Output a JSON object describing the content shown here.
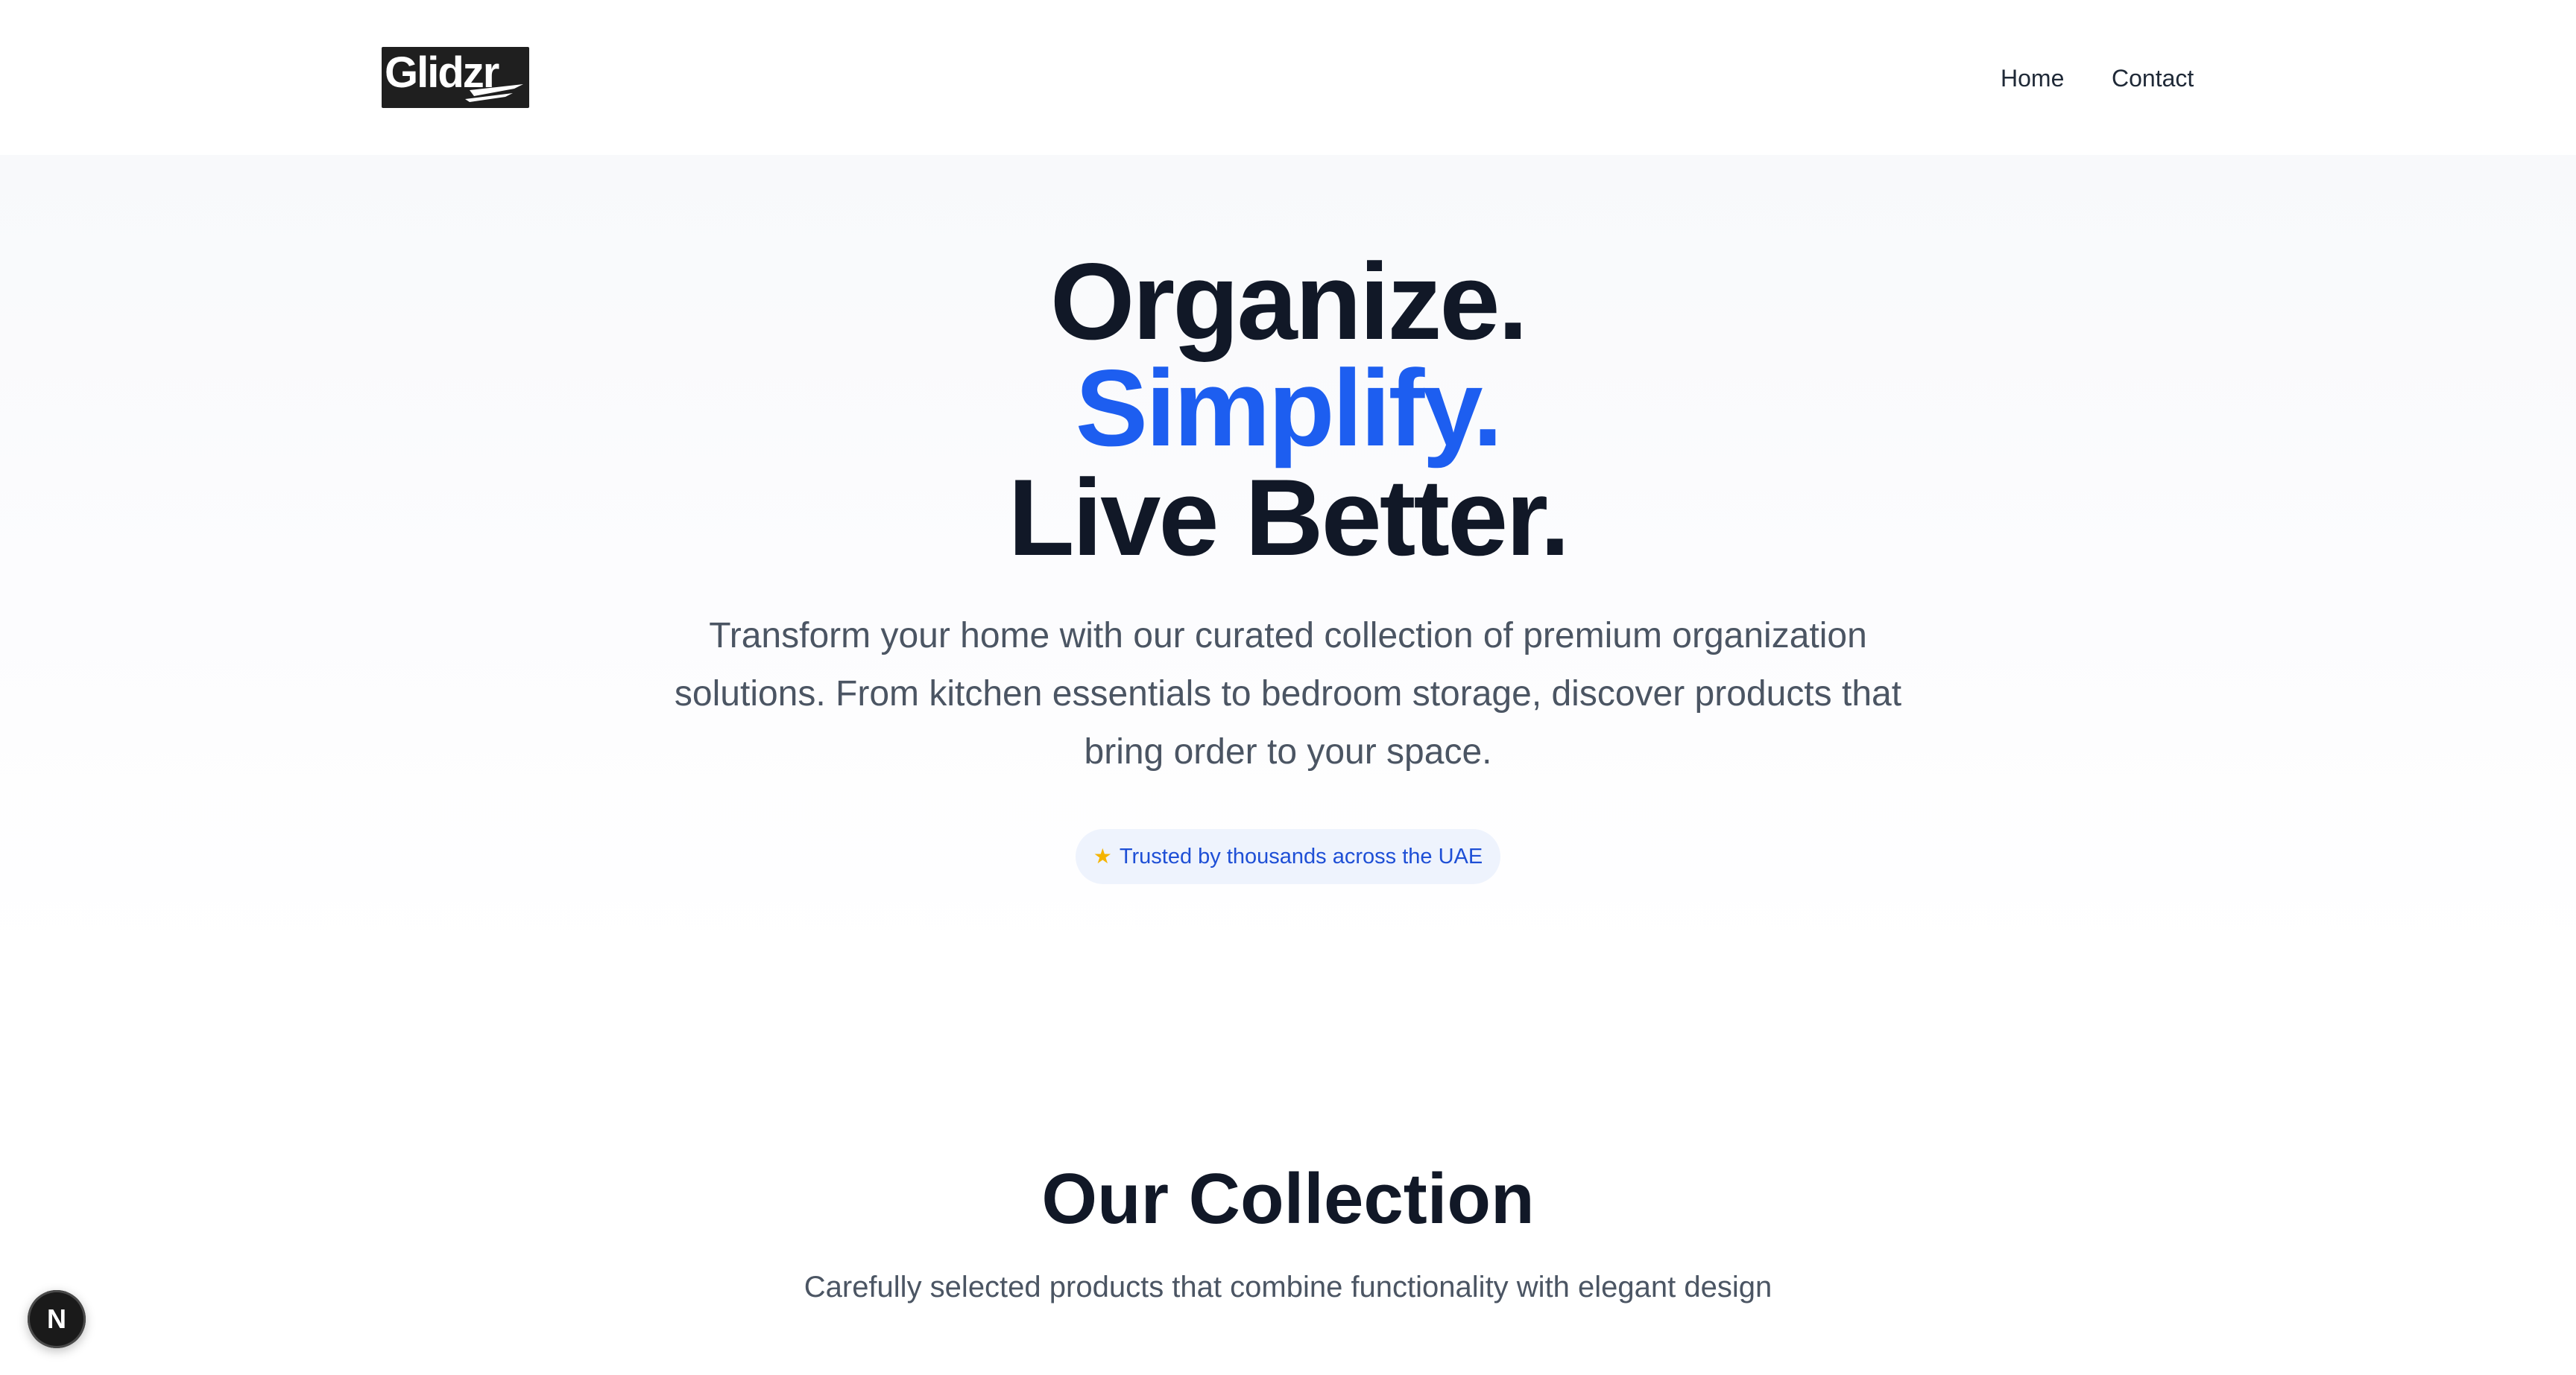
{
  "header": {
    "logo_text": "Glidzr",
    "nav": [
      {
        "label": "Home"
      },
      {
        "label": "Contact"
      }
    ]
  },
  "hero": {
    "line1": "Organize.",
    "line2": "Simplify.",
    "line3": "Live Better.",
    "subtitle": "Transform your home with our curated collection of premium organization solutions. From kitchen essentials to bedroom storage, discover products that bring order to your space.",
    "badge": {
      "icon": "star-icon",
      "text": "Trusted by thousands across the UAE"
    }
  },
  "collection": {
    "title": "Our Collection",
    "subtitle": "Carefully selected products that combine functionality with elegant design"
  },
  "dev_indicator": {
    "letter": "N",
    "icon": "nextjs-icon"
  },
  "colors": {
    "accent": "#1d5ef0",
    "heading": "#111827",
    "body": "#4b5563",
    "badge_bg": "#eef3fd",
    "badge_text": "#1e4fd6"
  }
}
